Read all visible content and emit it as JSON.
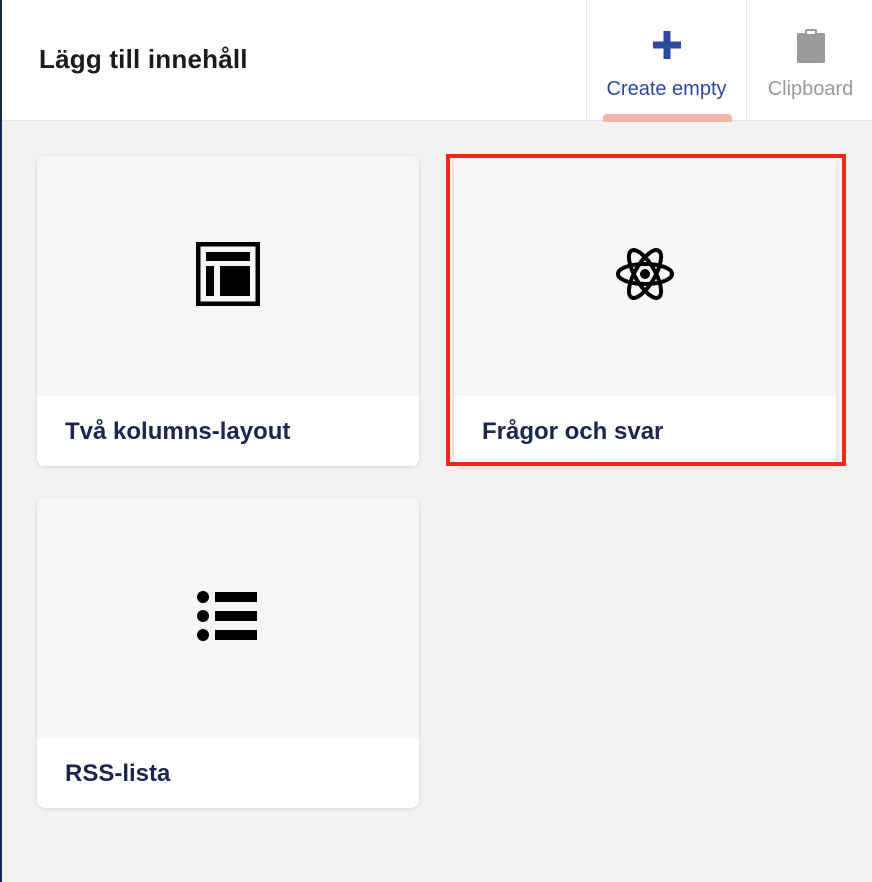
{
  "header": {
    "title": "Lägg till innehåll",
    "tabs": [
      {
        "label": "Create empty",
        "icon": "plus-icon",
        "active": true,
        "color": "#2e4a9e"
      },
      {
        "label": "Clipboard",
        "icon": "clipboard-icon",
        "active": false,
        "color": "#9a9a9a"
      }
    ]
  },
  "cards": [
    {
      "label": "Två kolumns-layout",
      "icon": "two-column-layout-icon"
    },
    {
      "label": "Frågor och svar",
      "icon": "atom-icon",
      "highlighted": true
    },
    {
      "label": "RSS-lista",
      "icon": "list-icon"
    }
  ],
  "colors": {
    "accent": "#2e4a9e",
    "card_title": "#1b264f",
    "highlight_border": "#f4261a",
    "tab_indicator": "#f4b4ac"
  }
}
